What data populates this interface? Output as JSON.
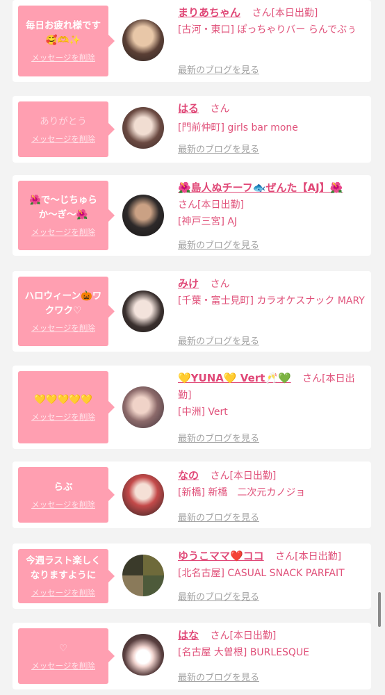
{
  "common": {
    "delete_label": "メッセージを削除",
    "blog_label": "最新のブログを見る",
    "san": "さん"
  },
  "cards": [
    {
      "message": "毎日お疲れ様です🥰🫶✨",
      "name": "まりあちゃん",
      "status": "[本日出勤]",
      "location": "[古河・東口] ぽっちゃりバー らんでぶぅ"
    },
    {
      "message": "ありがとう",
      "name": "はる",
      "status": "",
      "location": "[門前仲町] girls bar mone"
    },
    {
      "message": "🌺で〜じちゅらか〜ぎ〜🌺",
      "name": "🌺島人ぬチーフ🐟ぜんた【AJ】🌺",
      "status": "[本日出勤]",
      "location": "[神戸三宮] AJ"
    },
    {
      "message": "ハロウィーン🎃ワクワク♡",
      "name": "みけ",
      "status": "",
      "location": "[千葉・富士見町] カラオケスナック MARY"
    },
    {
      "message": "💛💛💛💛💛",
      "name": "💛YUNA💛 Vert🥂💚",
      "status": "[本日出勤]",
      "location": "[中洲] Vert"
    },
    {
      "message": "らぶ",
      "name": "なの",
      "status": "[本日出勤]",
      "location": "[新橋] 新橋　二次元カノジョ"
    },
    {
      "message": "今週ラスト楽しくなりますように",
      "name": "ゆうこママ❤️ココ",
      "status": "[本日出勤]",
      "location": "[北名古屋] CASUAL SNACK PARFAIT"
    },
    {
      "message": "♡",
      "name": "はな",
      "status": "[本日出勤]",
      "location": "[名古屋 大曽根] BURLESQUE"
    }
  ],
  "colors": {
    "accent": "#e0517a",
    "bubble": "#ff9fb1",
    "background": "#f3f3f3"
  }
}
